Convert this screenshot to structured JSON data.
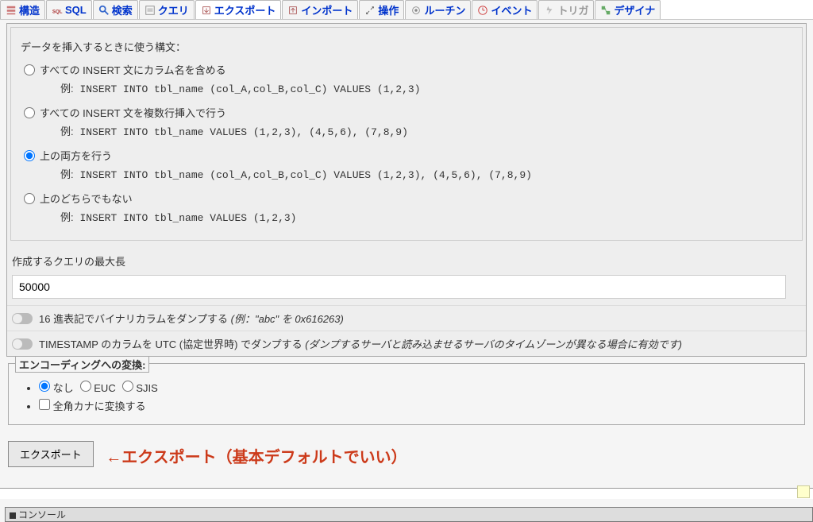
{
  "tabs": [
    {
      "label": "構造",
      "icon": "structure"
    },
    {
      "label": "SQL",
      "icon": "sql"
    },
    {
      "label": "検索",
      "icon": "search"
    },
    {
      "label": "クエリ",
      "icon": "query"
    },
    {
      "label": "エクスポート",
      "icon": "export",
      "active": true
    },
    {
      "label": "インポート",
      "icon": "import"
    },
    {
      "label": "操作",
      "icon": "operations"
    },
    {
      "label": "ルーチン",
      "icon": "routines"
    },
    {
      "label": "イベント",
      "icon": "events"
    },
    {
      "label": "トリガ",
      "icon": "triggers",
      "disabled": true
    },
    {
      "label": "デザイナ",
      "icon": "designer"
    }
  ],
  "syntax": {
    "title": "データを挿入するときに使う構文：",
    "options": [
      {
        "label": "すべての INSERT 文にカラム名を含める",
        "example_prefix": "例:",
        "example": "INSERT INTO tbl_name (col_A,col_B,col_C) VALUES (1,2,3)",
        "selected": false
      },
      {
        "label": "すべての INSERT 文を複数行挿入で行う",
        "example_prefix": "例:",
        "example": "INSERT INTO tbl_name VALUES (1,2,3), (4,5,6), (7,8,9)",
        "selected": false
      },
      {
        "label": "上の両方を行う",
        "example_prefix": "例:",
        "example": "INSERT INTO tbl_name (col_A,col_B,col_C) VALUES (1,2,3), (4,5,6), (7,8,9)",
        "selected": true
      },
      {
        "label": "上のどちらでもない",
        "example_prefix": "例:",
        "example": "INSERT INTO tbl_name VALUES (1,2,3)",
        "selected": false
      }
    ]
  },
  "maxlen": {
    "label": "作成するクエリの最大長",
    "value": "50000"
  },
  "toggles": {
    "hex": {
      "text": "16 進表記でバイナリカラムをダンプする ",
      "hint": "(例：\"abc\" を 0x616263)"
    },
    "utc": {
      "text": "TIMESTAMP のカラムを UTC (協定世界時) でダンプする ",
      "hint": "(ダンプするサーバと読み込ませるサーバのタイムゾーンが異なる場合に有効です)"
    }
  },
  "encoding": {
    "legend": "エンコーディングへの変換:",
    "none": "なし",
    "euc": "EUC",
    "sjis": "SJIS",
    "kana": "全角カナに変換する"
  },
  "export_button": "エクスポート",
  "annotation": "←エクスポート（基本デフォルトでいい）",
  "console": "コンソール"
}
